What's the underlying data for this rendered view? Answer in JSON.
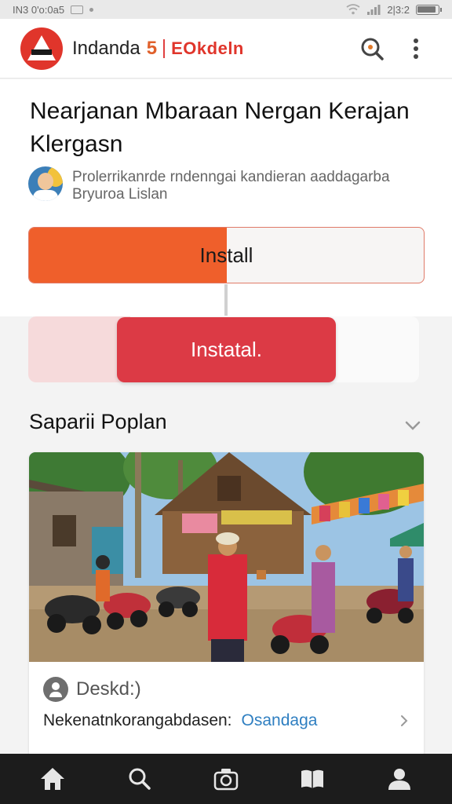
{
  "status_bar": {
    "left_text": "IN3 0'o:0a5",
    "right_text": "2|3:2",
    "battery_level": 0.9
  },
  "header": {
    "app_name": "Indanda",
    "app_number": "5",
    "brand": "EOkdeln",
    "icons": {
      "logo": "app-logo",
      "search": "search-icon",
      "more": "more-vert-icon"
    }
  },
  "hero": {
    "title": "Nearjanan Mbaraan Nergan Kerajan Klergasn",
    "author_text": "Prolerrikanrde rndenngai kandieran aaddagarba Bryuroa Lislan",
    "install_primary": {
      "label": "Install",
      "progress": 0.5
    },
    "install_secondary": {
      "label": "Instatal."
    }
  },
  "section": {
    "title": "Saparii Poplan"
  },
  "card": {
    "meta_label": "Deskd:)",
    "link_text": "Nekenatnkorangabdasen:",
    "link_accent": "Osandaga"
  },
  "bottom_nav": {
    "items": [
      "home-icon",
      "search-icon",
      "camera-icon",
      "book-icon",
      "profile-icon"
    ]
  },
  "colors": {
    "accent_orange": "#ef5f2b",
    "accent_red": "#dc3a45",
    "brand_red": "#e0352b",
    "link_blue": "#2f7fc1",
    "nav_bg": "#1c1c1c"
  }
}
